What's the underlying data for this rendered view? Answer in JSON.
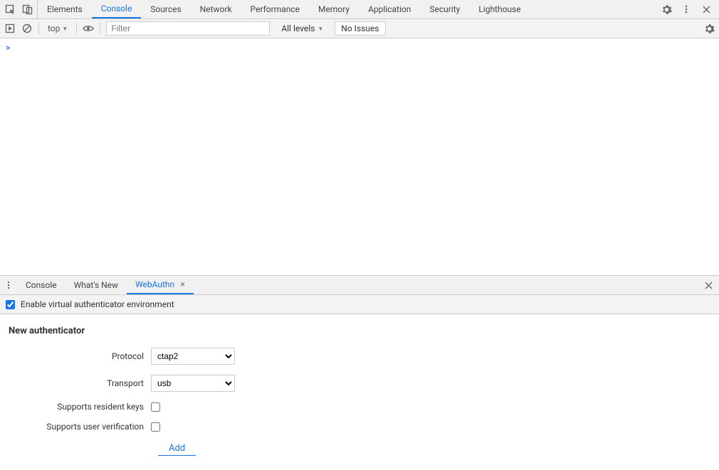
{
  "topTabs": {
    "items": [
      "Elements",
      "Console",
      "Sources",
      "Network",
      "Performance",
      "Memory",
      "Application",
      "Security",
      "Lighthouse"
    ],
    "activeIndex": 1
  },
  "consoleToolbar": {
    "context": "top",
    "filterPlaceholder": "Filter",
    "levels": "All levels",
    "issues": "No Issues"
  },
  "consolePrompt": ">",
  "drawer": {
    "tabs": [
      "Console",
      "What's New",
      "WebAuthn"
    ],
    "activeIndex": 2
  },
  "webauthn": {
    "enableLabel": "Enable virtual authenticator environment",
    "enableChecked": true,
    "sectionTitle": "New authenticator",
    "fields": {
      "protocolLabel": "Protocol",
      "protocolValue": "ctap2",
      "transportLabel": "Transport",
      "transportValue": "usb",
      "residentKeysLabel": "Supports resident keys",
      "residentKeysChecked": false,
      "userVerificationLabel": "Supports user verification",
      "userVerificationChecked": false
    },
    "addLabel": "Add"
  }
}
